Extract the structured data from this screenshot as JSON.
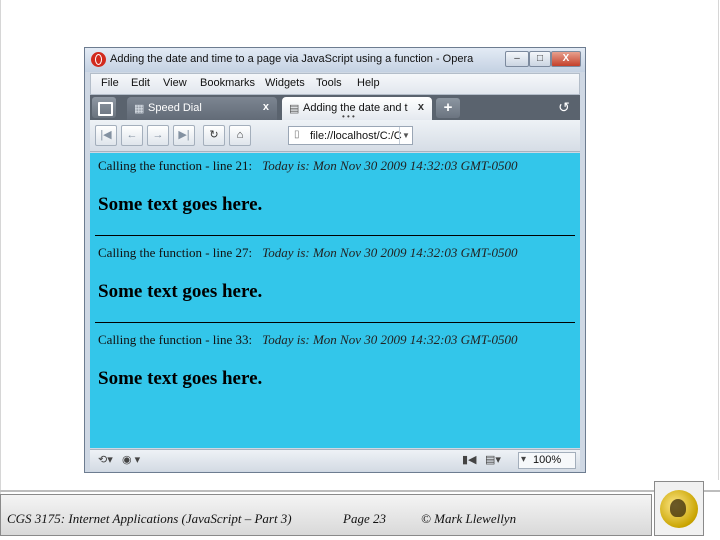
{
  "window": {
    "title": "Adding the date and time to a page via JavaScript using a function - Opera",
    "min_label": "–",
    "max_label": "□",
    "close_label": "X"
  },
  "menu": [
    "File",
    "Edit",
    "View",
    "Bookmarks",
    "Widgets",
    "Tools",
    "Help"
  ],
  "tabs": [
    {
      "icon": "speed-dial-icon",
      "glyph": "▦",
      "label": "Speed Dial",
      "close": "x",
      "active": false
    },
    {
      "icon": "page-icon",
      "glyph": "▤",
      "label": "Adding the date and ti...",
      "close": "x",
      "active": true
    }
  ],
  "tab_dots": "• • •",
  "newtab_label": "+",
  "toolbar": {
    "buttons": [
      {
        "name": "rewind-button",
        "glyph": "|◀",
        "active": false
      },
      {
        "name": "back-button",
        "glyph": "←",
        "active": false
      },
      {
        "name": "forward-button",
        "glyph": "→",
        "active": false
      },
      {
        "name": "fast-forward-button",
        "glyph": "▶|",
        "active": false
      },
      {
        "name": "reload-button",
        "glyph": "↻",
        "active": true
      },
      {
        "name": "home-button",
        "glyph": "⌂",
        "active": true
      }
    ],
    "address": "file://localhost/C:/C",
    "address_drop": "▼"
  },
  "content": {
    "blocks": [
      {
        "call": "Calling the function - line 21:",
        "today": "Today is: Mon Nov 30 2009 14:32:03 GMT-0500",
        "text": "Some text goes here."
      },
      {
        "call": "Calling the function - line 27:",
        "today": "Today is: Mon Nov 30 2009 14:32:03 GMT-0500",
        "text": "Some text goes here."
      },
      {
        "call": "Calling the function - line 33:",
        "today": "Today is: Mon Nov 30 2009 14:32:03 GMT-0500",
        "text": "Some text goes here."
      }
    ],
    "background": "#33c6ea"
  },
  "statusbar": {
    "zoom": "100%"
  },
  "footer": {
    "course": "CGS 3175: Internet Applications (JavaScript – Part 3)",
    "page": "Page 23",
    "copyright": "© Mark Llewellyn"
  }
}
